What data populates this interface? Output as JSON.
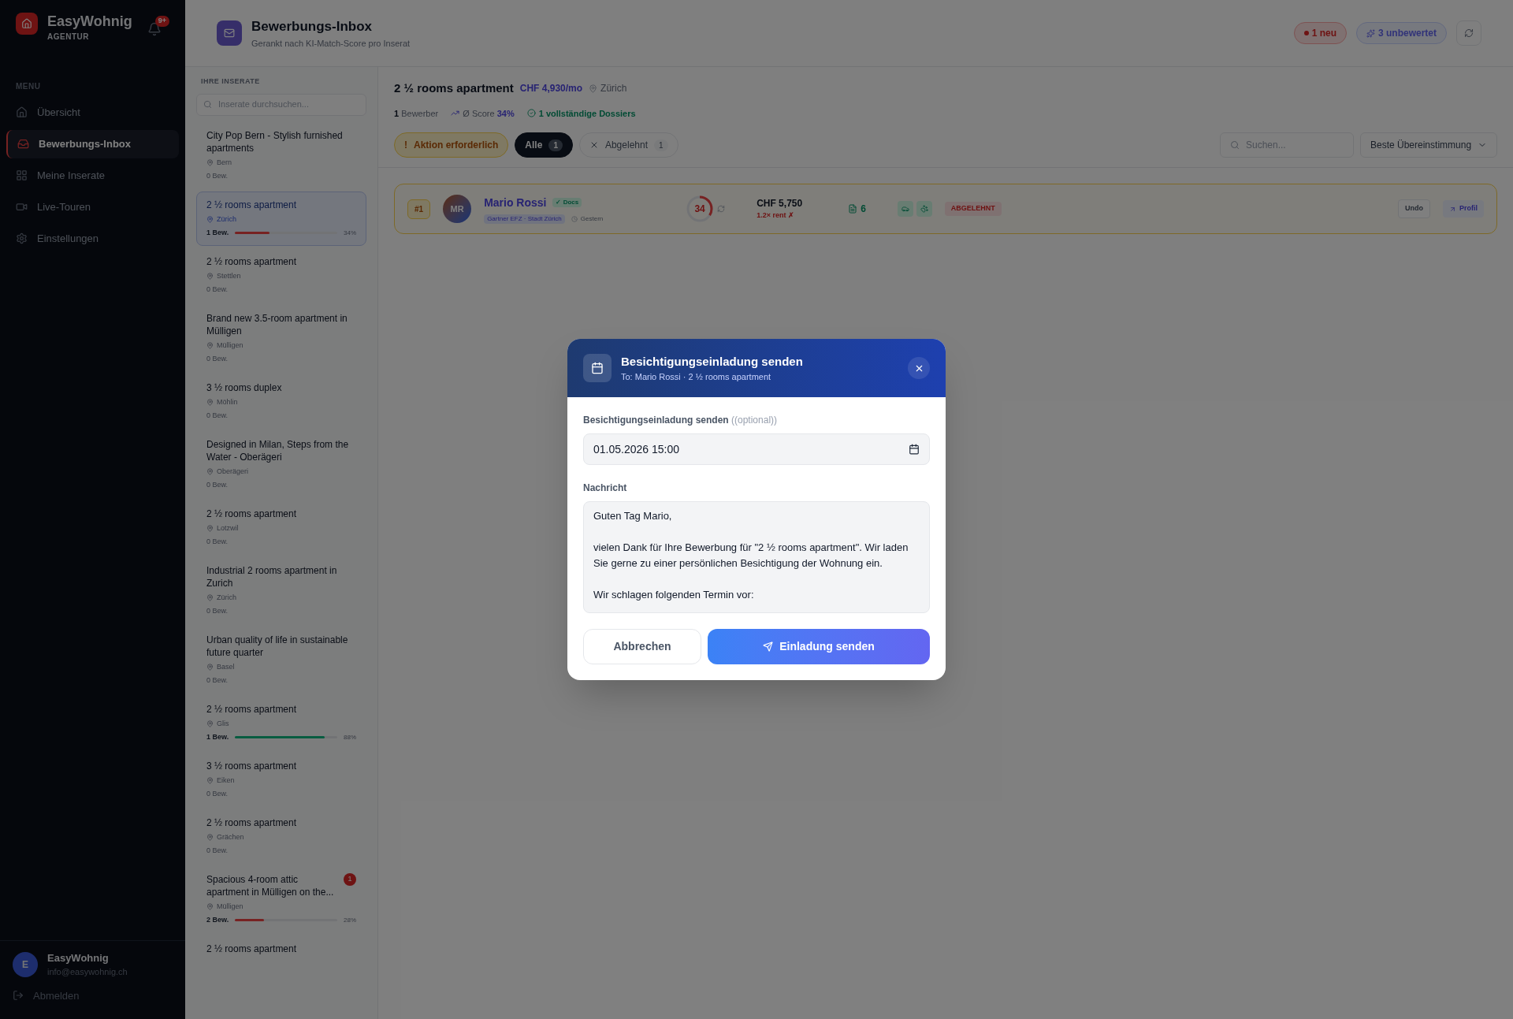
{
  "sidebar": {
    "brand": "EasyWohnig",
    "brand_sub": "AGENTUR",
    "notification_count": "9+",
    "menu_label": "MENU",
    "items": [
      {
        "label": "Übersicht",
        "selected": false
      },
      {
        "label": "Bewerbungs-Inbox",
        "selected": true
      },
      {
        "label": "Meine Inserate",
        "selected": false
      },
      {
        "label": "Live-Touren",
        "selected": false
      },
      {
        "label": "Einstellungen",
        "selected": false
      }
    ],
    "user": {
      "initial": "E",
      "name": "EasyWohnig",
      "email": "info@easywohnig.ch"
    },
    "logout": "Abmelden"
  },
  "header": {
    "title": "Bewerbungs-Inbox",
    "subtitle": "Gerankt nach KI-Match-Score pro Inserat",
    "new_badge": "1 neu",
    "unrated_badge": "3 unbewertet"
  },
  "listings_panel": {
    "label": "IHRE INSERATE",
    "search_placeholder": "Inserate durchsuchen...",
    "items": [
      {
        "title": "City Pop Bern - Stylish furnished apartments",
        "location": "Bern",
        "applicants": "0 Bew.",
        "selected": false
      },
      {
        "title": "2 ½ rooms apartment",
        "location": "Zürich",
        "applicants": "1 Bew.",
        "level": 0.34,
        "percent": "34%",
        "selected": true
      },
      {
        "title": "2 ½ rooms apartment",
        "location": "Stettlen",
        "applicants": "0 Bew.",
        "selected": false
      },
      {
        "title": "Brand new 3.5-room apartment in Mülligen",
        "location": "Mülligen",
        "applicants": "0 Bew.",
        "selected": false
      },
      {
        "title": "3 ½ rooms duplex",
        "location": "Möhlin",
        "applicants": "0 Bew.",
        "selected": false
      },
      {
        "title": "Designed in Milan, Steps from the Water - Oberägeri",
        "location": "Oberägeri",
        "applicants": "0 Bew.",
        "selected": false
      },
      {
        "title": "2 ½ rooms apartment",
        "location": "Lotzwil",
        "applicants": "0 Bew.",
        "selected": false
      },
      {
        "title": "Industrial 2 rooms apartment in Zurich",
        "location": "Zürich",
        "applicants": "0 Bew.",
        "selected": false
      },
      {
        "title": "Urban quality of life in sustainable future quarter",
        "location": "Basel",
        "applicants": "0 Bew.",
        "selected": false
      },
      {
        "title": "2 ½ rooms apartment",
        "location": "Glis",
        "applicants": "1 Bew.",
        "level": 0.88,
        "percent": "88%",
        "selected": false
      },
      {
        "title": "3 ½ rooms apartment",
        "location": "Eiken",
        "applicants": "0 Bew.",
        "selected": false
      },
      {
        "title": "2 ½ rooms apartment",
        "location": "Grächen",
        "applicants": "0 Bew.",
        "selected": false
      },
      {
        "title": "Spacious 4-room attic apartment in Mülligen on the...",
        "location": "Mülligen",
        "applicants": "2 Bew.",
        "level": 0.28,
        "percent": "28%",
        "badge": "1",
        "selected": false
      },
      {
        "title": "2 ½ rooms apartment",
        "selected": false
      }
    ]
  },
  "detail": {
    "title": "2 ½ rooms apartment",
    "price": "CHF 4,930/mo",
    "location": "Zürich",
    "applicant_count": "1",
    "applicant_label": "Bewerber",
    "score_label": "Ø Score",
    "score": "34%",
    "dossiers": "1 vollständige Dossiers",
    "filters": [
      {
        "label": "Aktion erforderlich",
        "marker": "!",
        "kind": "action",
        "selected": false
      },
      {
        "label": "Alle",
        "count": "1",
        "kind": "count",
        "selected": true
      },
      {
        "label": "Abgelehnt",
        "count": "1",
        "kind": "rejected",
        "selected": false
      }
    ],
    "search_placeholder": "Suchen...",
    "sort": "Beste Übereinstimmung",
    "applicants": [
      {
        "rank": "#1",
        "initials": "MR",
        "name": "Mario Rossi",
        "docs_badge": "✓ Docs",
        "tag": "Gartner EFZ · Stadt Zürich",
        "time": "Gestern",
        "score": "34",
        "level": 0.34,
        "rent": "CHF 5,750",
        "rent_ratio": "1.2× rent ✗",
        "documents": "6",
        "status": "ABGELEHNT",
        "undo": "Undo",
        "profile": "Profil"
      }
    ]
  },
  "modal": {
    "title": "Besichtigungseinladung senden",
    "subtitle": "To: Mario Rossi · 2 ½ rooms apartment",
    "date_label": "Besichtigungseinladung senden",
    "date_hint": "((optional))",
    "date_value": "01.05.2026 15:00",
    "message_label": "Nachricht",
    "message": "Guten Tag Mario,\n\nvielen Dank für Ihre Bewerbung für \"2 ½ rooms apartment\". Wir laden Sie gerne zu einer persönlichen Besichtigung der Wohnung ein.\n\nWir schlagen folgenden Termin vor:",
    "cancel": "Abbrechen",
    "submit": "Einladung senden"
  }
}
